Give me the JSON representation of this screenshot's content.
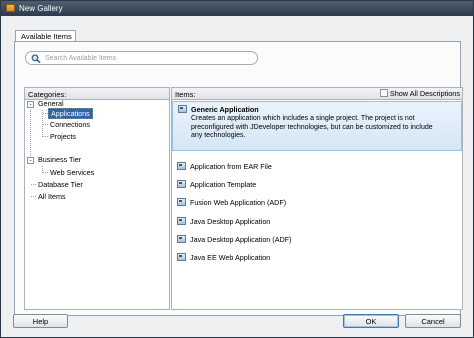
{
  "window": {
    "title": "New Gallery"
  },
  "tabs": [
    {
      "label": "Available Items"
    }
  ],
  "search": {
    "placeholder": "Search Available Items",
    "value": ""
  },
  "categories": {
    "header": "Categories:",
    "nodes": [
      {
        "label": "General",
        "expander": "-"
      },
      {
        "label": "Applications",
        "selected": true
      },
      {
        "label": "Connections"
      },
      {
        "label": "Projects"
      },
      {
        "label": "Business Tier",
        "expander": "-"
      },
      {
        "label": "Web Services"
      },
      {
        "label": "Database Tier"
      },
      {
        "label": "All Items"
      }
    ]
  },
  "items": {
    "header": "Items:",
    "show_all_label": "Show All Descriptions",
    "show_all_checked": false,
    "list": [
      {
        "name": "Generic Application",
        "description": "Creates an application which includes a single project. The project is not preconfigured with JDeveloper technologies, but can be customized to include any technologies.",
        "selected": true
      },
      {
        "name": "Application from EAR File"
      },
      {
        "name": "Application Template"
      },
      {
        "name": "Fusion Web Application (ADF)"
      },
      {
        "name": "Java Desktop Application"
      },
      {
        "name": "Java Desktop Application (ADF)"
      },
      {
        "name": "Java EE Web Application"
      }
    ]
  },
  "buttons": {
    "help": "Help",
    "ok": "OK",
    "cancel": "Cancel"
  }
}
